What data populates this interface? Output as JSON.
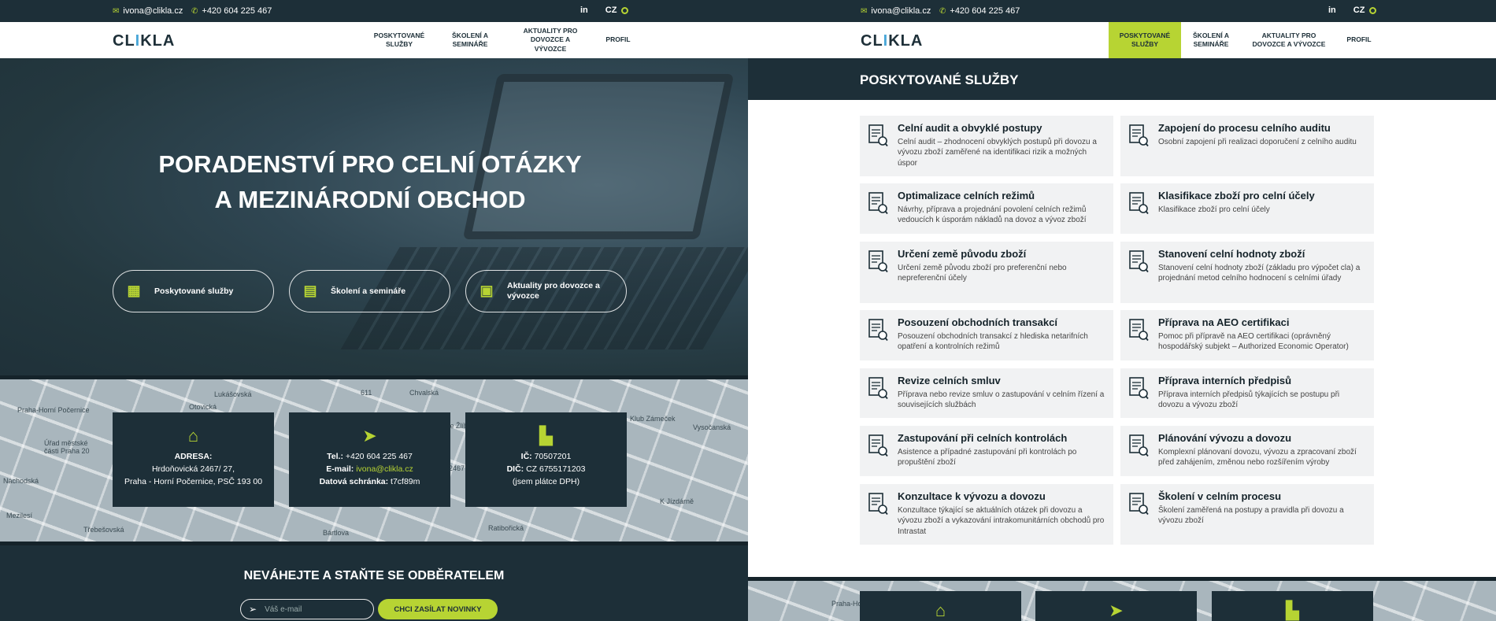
{
  "colors": {
    "accent": "#b7d433",
    "dark": "#1d2f38",
    "light_bg": "#f1f2f3"
  },
  "topbar": {
    "email": "ivona@clikla.cz",
    "phone": "+420 604 225 467",
    "social": "in",
    "lang": "CZ",
    "icons": {
      "email": "envelope-icon",
      "phone": "phone-icon",
      "social": "linkedin-icon",
      "lang": "flag-icon"
    }
  },
  "logo": {
    "part1": "CL",
    "part2": "I",
    "part3": "KLA"
  },
  "nav": {
    "items": [
      {
        "label": "POSKYTOVANÉ SLUŽBY"
      },
      {
        "label": "ŠKOLENÍ A SEMINÁŘE"
      },
      {
        "label": "AKTUALITY PRO DOVOZCE A VÝVOZCE"
      },
      {
        "label": "PROFIL"
      }
    ]
  },
  "hero": {
    "title_line1": "PORADENSTVÍ PRO CELNÍ OTÁZKY",
    "title_line2": "A MEZINÁRODNÍ OBCHOD",
    "buttons": [
      {
        "label": "Poskytované služby",
        "icon": "services-icon"
      },
      {
        "label": "Školení a semináře",
        "icon": "training-icon"
      },
      {
        "label": "Aktuality pro dovozce a vývozce",
        "icon": "news-icon"
      }
    ]
  },
  "map_labels": [
    "Praha-Horní Počernice",
    "Úřad městské části Praha 20",
    "Náchodská",
    "Mezilesí",
    "Třebešovská",
    "Ve Žlíbku",
    "Klub Zámeček",
    "Lukášovská",
    "Otovická",
    "Chvalská",
    "611",
    "2467",
    "Bártlova",
    "K Jízdárně",
    "Ratibořická",
    "Vysočanská"
  ],
  "contact_cards": [
    {
      "icon": "home-icon",
      "title": "ADRESA:",
      "line1": "Hrdoňovická 2467/ 27,",
      "line2": "Praha - Horní Počernice, PSČ 193 00"
    },
    {
      "icon": "send-icon",
      "tel_label": "Tel.:",
      "tel": "+420 604 225 467",
      "email_label": "E-mail:",
      "email": "ivona@clikla.cz",
      "box_label": "Datová schránka:",
      "box": "t7cf89m"
    },
    {
      "icon": "company-icon",
      "ic_label": "IČ:",
      "ic": "70507201",
      "dic_label": "DIČ:",
      "dic": "CZ 6755171203",
      "note": "(jsem plátce DPH)"
    }
  ],
  "newsletter": {
    "title": "NEVÁHEJTE A STAŇTE SE ODBĚRATELEM",
    "placeholder": "Váš e-mail",
    "button": "CHCI ZASÍLAT NOVINKY"
  },
  "services_section": {
    "title": "POSKYTOVANÉ SLUŽBY",
    "items": [
      {
        "title": "Celní audit a obvyklé postupy",
        "desc": "Celní audit – zhodnocení obvyklých postupů při dovozu a vývozu zboží zaměřené na identifikaci rizik a možných úspor"
      },
      {
        "title": "Zapojení do procesu celního auditu",
        "desc": "Osobní zapojení při realizaci doporučení z celního auditu"
      },
      {
        "title": "Optimalizace celních režimů",
        "desc": "Návrhy, příprava a projednání povolení celních režimů vedoucích k úsporám nákladů na dovoz a vývoz zboží"
      },
      {
        "title": "Klasifikace zboží pro celní účely",
        "desc": "Klasifikace zboží pro celní účely"
      },
      {
        "title": "Určení země původu zboží",
        "desc": "Určení země původu zboží pro preferenční nebo nepreferenční účely"
      },
      {
        "title": "Stanovení celní hodnoty zboží",
        "desc": "Stanovení celní hodnoty zboží (základu pro výpočet cla) a projednání metod celního hodnocení s celními úřady"
      },
      {
        "title": "Posouzení obchodních transakcí",
        "desc": "Posouzení obchodních transakcí z hlediska netarifních opatření a kontrolních režimů"
      },
      {
        "title": "Příprava na AEO certifikaci",
        "desc": "Pomoc při přípravě na AEO certifikaci (oprávněný hospodářský subjekt – Authorized Economic Operator)"
      },
      {
        "title": "Revize celních smluv",
        "desc": "Příprava nebo revize smluv o zastupování v celním řízení a souvisejících službách"
      },
      {
        "title": "Příprava interních předpisů",
        "desc": "Příprava interních předpisů týkajících se postupu při dovozu a vývozu zboží"
      },
      {
        "title": "Zastupování při celních kontrolách",
        "desc": "Asistence a případné zastupování při kontrolách po propuštění zboží"
      },
      {
        "title": "Plánování vývozu a dovozu",
        "desc": "Komplexní plánovaní dovozu, vývozu a zpracovaní zboží před zahájením, změnou nebo rozšířením výroby"
      },
      {
        "title": "Konzultace k vývozu a dovozu",
        "desc": "Konzultace týkající se aktuálních otázek při dovozu a vývozu zboží a vykazování intrakomunitárních obchodů pro Intrastat"
      },
      {
        "title": "Školení v celním procesu",
        "desc": "Školení zaměřená na postupy a pravidla při dovozu a vývozu zboží"
      }
    ]
  }
}
